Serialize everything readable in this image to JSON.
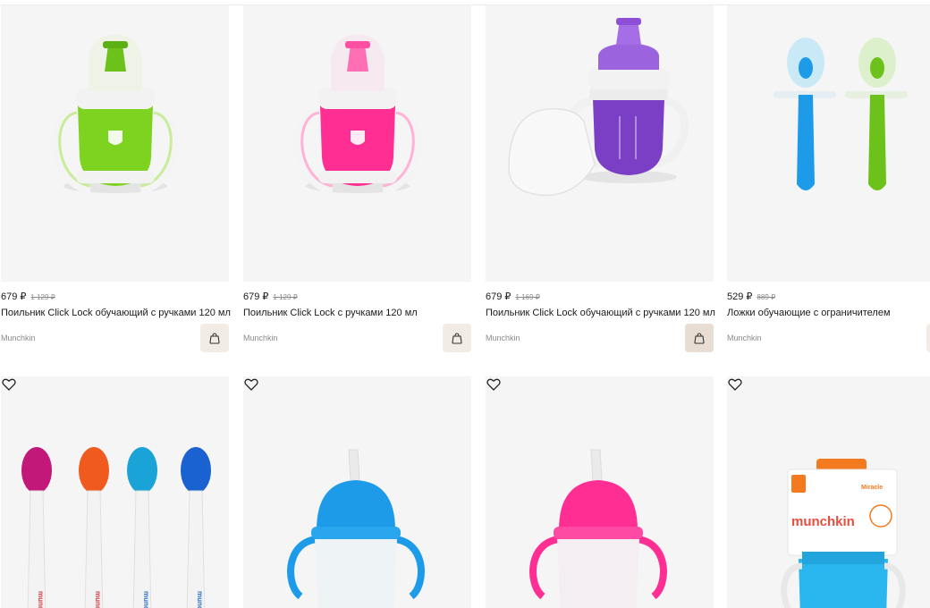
{
  "products": [
    {
      "price": "679 ₽",
      "old_price": "1 129 ₽",
      "title": "Поильник Click Lock обучающий с ручками 120 мл",
      "brand": "Munchkin",
      "image": "green-sippy-cup"
    },
    {
      "price": "679 ₽",
      "old_price": "1 129 ₽",
      "title": "Поильник Click Lock с ручками 120 мл",
      "brand": "Munchkin",
      "image": "pink-sippy-cup"
    },
    {
      "price": "679 ₽",
      "old_price": "1 169 ₽",
      "title": "Поильник Click Lock обучающий с ручками 120 мл",
      "brand": "Munchkin",
      "image": "purple-sippy-cup"
    },
    {
      "price": "529 ₽",
      "old_price": "889 ₽",
      "title": "Ложки обучающие с ограничителем",
      "brand": "Munchkin",
      "image": "training-spoons"
    },
    {
      "image": "colored-spoons",
      "image_text": "munchkin"
    },
    {
      "image": "blue-straw-cup"
    },
    {
      "image": "pink-straw-cup"
    },
    {
      "image": "miracle-cup-package",
      "image_text": "munchkin",
      "image_subtext": "Miracle"
    }
  ],
  "colors": {
    "card_bg": "#f5f5f5",
    "cart_bg": "#f3ece4",
    "green": "#7ed321",
    "pink": "#ff2e93",
    "purple": "#7a3fc4",
    "blue": "#1e9be8"
  }
}
